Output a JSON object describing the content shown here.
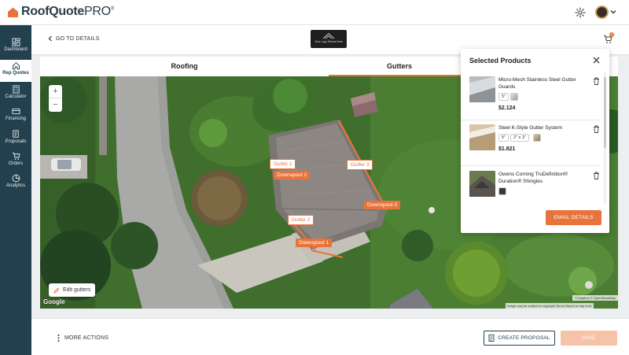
{
  "app": {
    "logo_name": "RoofQuote",
    "logo_suffix": "PRO",
    "logo_mark": "®"
  },
  "sidebar": {
    "items": [
      {
        "label": "Dashboard",
        "icon": "dashboard-icon"
      },
      {
        "label": "Rep Quotes",
        "icon": "home-icon",
        "active": true
      },
      {
        "label": "Calculator",
        "icon": "calculator-icon"
      },
      {
        "label": "Financing",
        "icon": "wallet-icon"
      },
      {
        "label": "Proposals",
        "icon": "proposals-icon"
      },
      {
        "label": "Orders",
        "icon": "cart-icon"
      },
      {
        "label": "Analytics",
        "icon": "pie-chart-icon"
      }
    ]
  },
  "header": {
    "back_label": "GO TO DETAILS",
    "brand_placeholder": "Your Logo Shows Here",
    "cart_count": "2"
  },
  "tabs": [
    {
      "label": "Roofing",
      "active": false
    },
    {
      "label": "Gutters",
      "active": true
    }
  ],
  "map": {
    "zoom_in": "+",
    "zoom_out": "−",
    "edit_label": "Edit gutters",
    "google": "Google",
    "attribution": "© Mapbox © OpenStreetMap",
    "attribution2": "Image may be subject to copyright   Terms   Report a map error",
    "labels": {
      "gutter1": "Gutter 1",
      "gutter2": "Gutter 2",
      "gutter3": "Gutter 3",
      "downspout1": "Downspout 1",
      "downspout2": "Downspout 2",
      "downspout3": "Downspout 3"
    }
  },
  "panel": {
    "title": "Selected Products",
    "products": [
      {
        "name": "Micro-Mesh Stainless Steel Gutter Guards",
        "options": [
          "5\""
        ],
        "price": "$2.124"
      },
      {
        "name": "Steel K-Style Gutter System",
        "options": [
          "5\"",
          "2\" x 3\""
        ],
        "price": "$1.821"
      },
      {
        "name": "Owens Corning TruDefinition® Duration® Shingles",
        "options": [],
        "price": ""
      }
    ],
    "email_label": "EMAIL DETAILS"
  },
  "footer": {
    "more_actions": "MORE ACTIONS",
    "create_proposal": "CREATE PROPOSAL",
    "save": "SAVE"
  },
  "colors": {
    "accent": "#e8743b",
    "sidebar": "#23404e",
    "save_disabled": "#f7c3a8"
  }
}
